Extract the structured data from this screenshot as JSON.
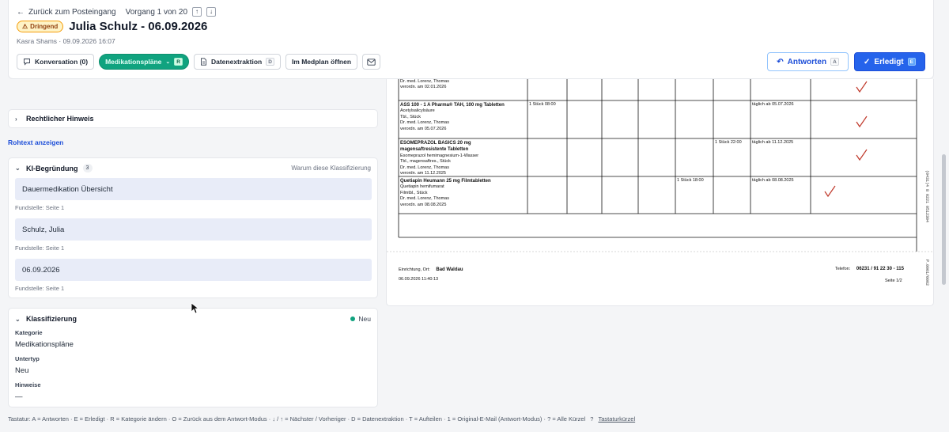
{
  "nav": {
    "back_label": "Zurück zum Posteingang",
    "counter": "Vorgang 1 von 20",
    "up": "↑",
    "down": "↓"
  },
  "header": {
    "urgent_badge": "Dringend",
    "title": "Julia Schulz - 06.09.2026",
    "meta": "Kasra Shams · 09.09.2026 16:07"
  },
  "actions": {
    "conversation": "Konversation (0)",
    "medplan": "Medikationspläne",
    "medplan_kbd": "R",
    "extraction": "Datenextraktion",
    "extraction_kbd": "D",
    "open_medplan": "Im Medplan öffnen",
    "reply": "Antworten",
    "reply_kbd": "A",
    "done": "Erledigt",
    "done_kbd": "E"
  },
  "legal": {
    "label": "Rechtlicher Hinweis"
  },
  "rohtext": "Rohtext anzeigen",
  "ki": {
    "title": "KI-Begründung",
    "count": "3",
    "why": "Warum diese Klassifizierung",
    "items": [
      {
        "text": "Dauermedikation Übersicht",
        "source": "Fundstelle: Seite 1"
      },
      {
        "text": "Schulz, Julia",
        "source": "Fundstelle: Seite 1"
      },
      {
        "text": "06.09.2026",
        "source": "Fundstelle: Seite 1"
      }
    ]
  },
  "klass": {
    "title": "Klassifizierung",
    "status": "Neu",
    "status_color": "#10a37f",
    "fields": [
      {
        "label": "Kategorie",
        "value": "Medikationspläne"
      },
      {
        "label": "Untertyp",
        "value": "Neu"
      },
      {
        "label": "Hinweise",
        "value": "—"
      }
    ]
  },
  "doc": {
    "row0": {
      "line1": "Dr. med. Lorenz, Thomas",
      "line2": "verordn. am 02.01.2026"
    },
    "rows": [
      {
        "name": "ASS 100 - 1 A Pharma® TAH, 100 mg Tabletten",
        "sub1": "Acetylsalicylsäure",
        "sub2": "Tbl., Stück",
        "sub3": "Dr. med. Lorenz, Thomas",
        "sub4": "verordn. am 05.07.2026",
        "dose": "1 Stück 08:00",
        "since": "täglich ab 05.07.2026"
      },
      {
        "name": "ESOMEPRAZOL BASICS 20 mg",
        "name2": "magensaftresistente Tabletten",
        "sub1": "Esomeprazol hemimagnesium-1-Wasser",
        "sub2": "Tbl., magensaftres., Stück",
        "sub3": "Dr. med. Lorenz, Thomas",
        "sub4": "verordn. am 11.12.2025",
        "dose": "1 Stück 22:00",
        "since": "täglich ab 11.12.2025"
      },
      {
        "name": "Quetiapin Heumann 25 mg Filmtabletten",
        "sub1": "Quetiapin hemifumarat",
        "sub2": "Filmtbl., Stück",
        "sub3": "Dr. med. Lorenz, Thomas",
        "sub4": "verordn. am 08.08.2025",
        "dose": "1 Stück 18:00",
        "since": "täglich ab 08.08.2025"
      }
    ],
    "footer": {
      "einrichtung": "Einrichtung, Ort:",
      "ort": "Bad Waldau",
      "datetime": "06.09.2026 11:40:13",
      "telefon": "Telefon:",
      "telnr": "06231 / 91 22 30 - 115",
      "seite": "Seite 1/2"
    }
  },
  "footer": {
    "shortcuts": "Tastatur: A = Antworten · E = Erledigt · R = Kategorie ändern · O = Zurück aus dem Antwort-Modus · ↓ / ↑ = Nächster / Vorheriger · D = Datenextraktion · T = Aufteilen · 1 = Original-E-Mail (Antwort-Modus) · ? = Alle Kürzel",
    "help": "?",
    "link": "Tastaturkürzel"
  }
}
